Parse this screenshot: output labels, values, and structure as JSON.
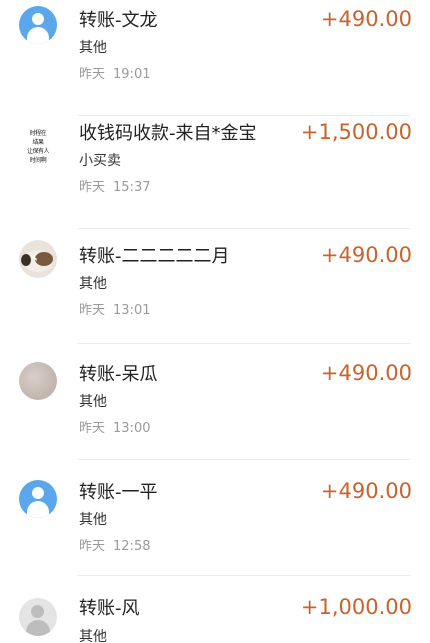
{
  "transactions": [
    {
      "title": "转账-文龙",
      "note": "其他",
      "day": "昨天",
      "time": "19:01",
      "amount": "+490.00",
      "avatar": "default-user-icon"
    },
    {
      "title": "收钱码收款-来自*金宝",
      "note": "小买卖",
      "day": "昨天",
      "time": "15:37",
      "amount": "+1,500.00",
      "avatar": "text-avatar",
      "avatar_text": [
        "时程在",
        "结果",
        "让保有人",
        "时间啊"
      ]
    },
    {
      "title": "转账-二二二二二月",
      "note": "其他",
      "day": "昨天",
      "time": "13:01",
      "amount": "+490.00",
      "avatar": "cat-photo"
    },
    {
      "title": "转账-呆瓜",
      "note": "其他",
      "day": "昨天",
      "time": "13:00",
      "amount": "+490.00",
      "avatar": "stone-photo"
    },
    {
      "title": "转账-一平",
      "note": "其他",
      "day": "昨天",
      "time": "12:58",
      "amount": "+490.00",
      "avatar": "default-user-icon"
    },
    {
      "title": "转账-风",
      "note": "其他",
      "day": "",
      "time": "",
      "amount": "+1,000.00",
      "avatar": "gray-user-icon"
    }
  ],
  "colors": {
    "amount": "#c9622c",
    "avatar_default": "#5aa7ec",
    "secondary_text": "#9a9a9a"
  }
}
